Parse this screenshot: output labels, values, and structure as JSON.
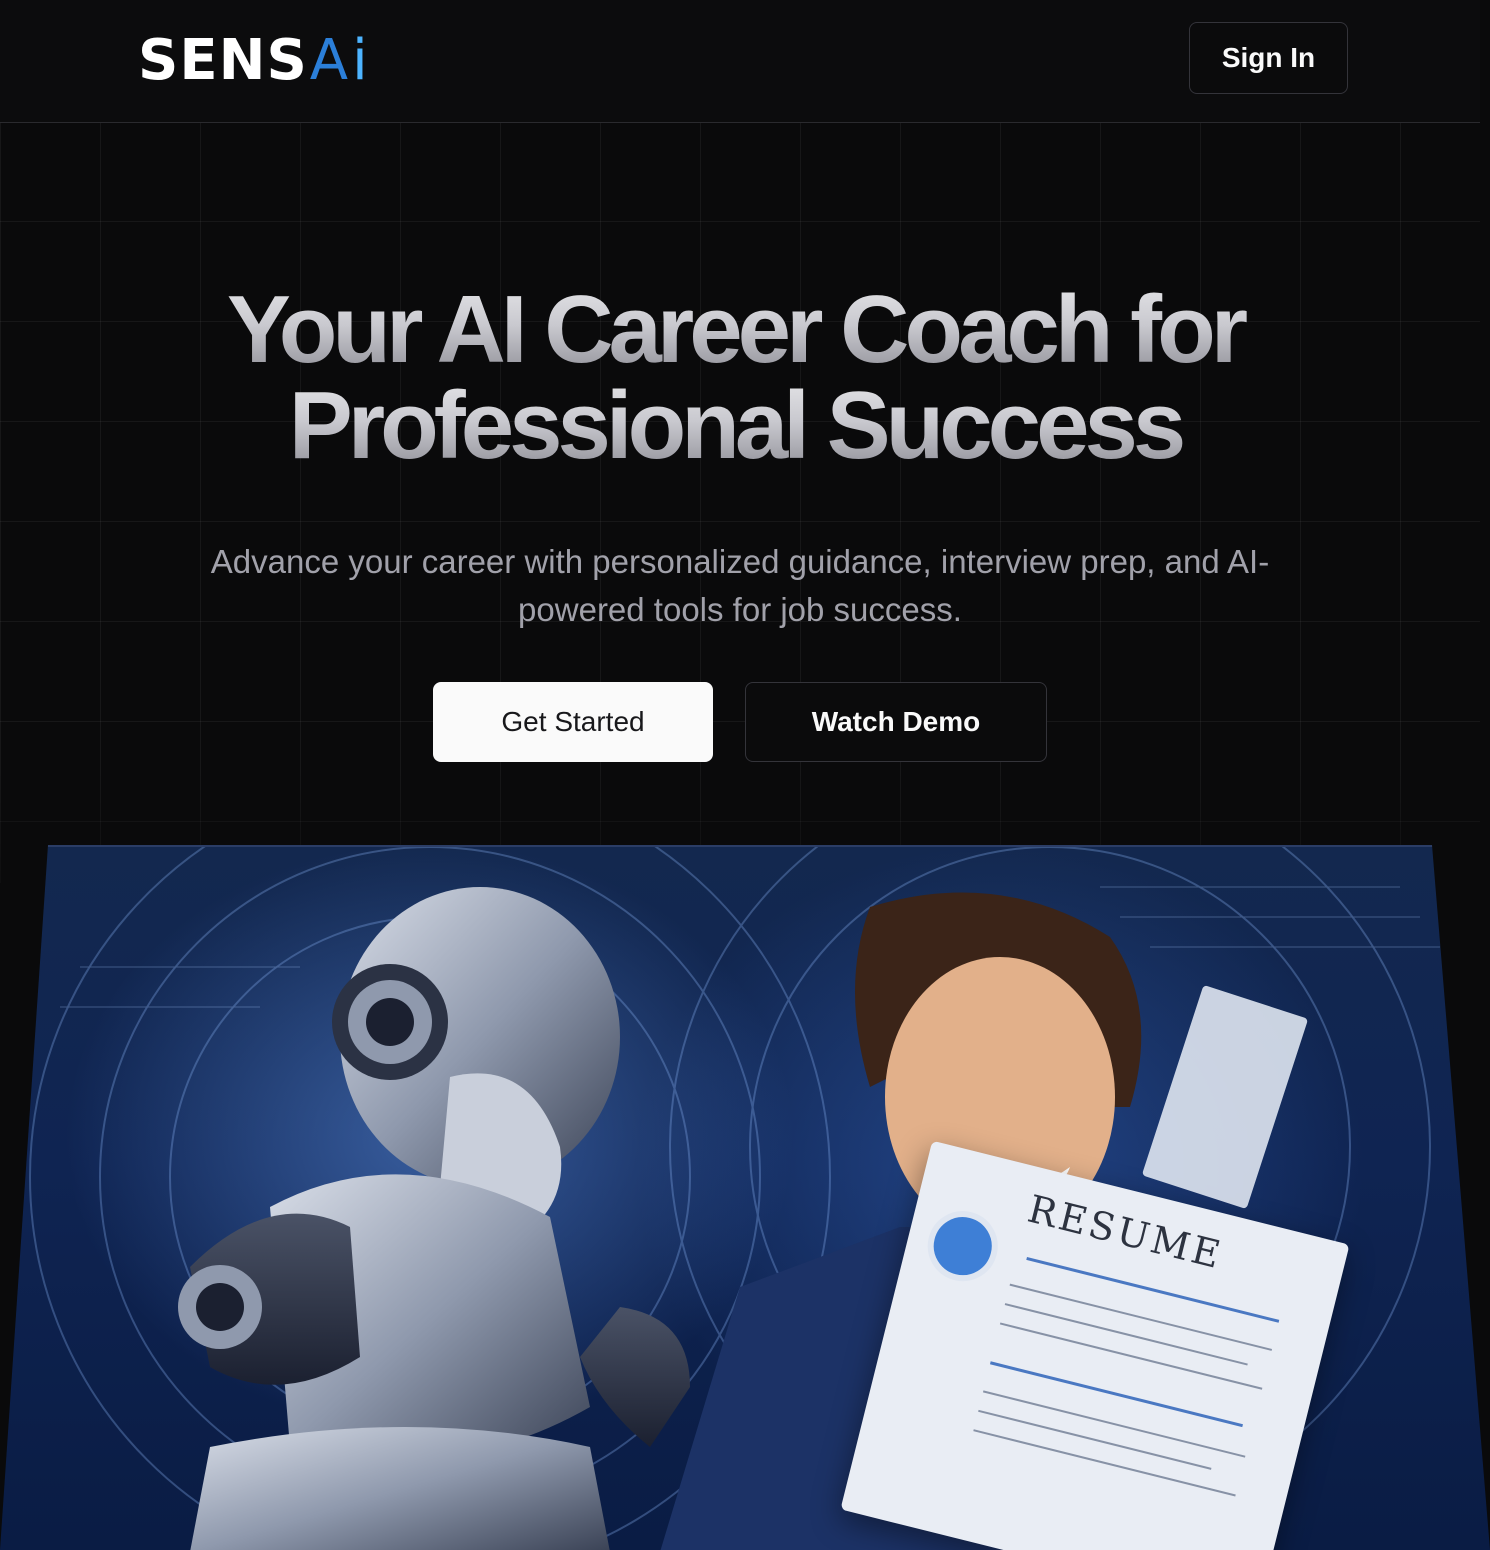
{
  "brand": {
    "logo_prefix": "SENS",
    "logo_suffix_a": "A",
    "logo_suffix_i": "i",
    "accent_color": "#2b7fd9"
  },
  "header": {
    "sign_in_label": "Sign In"
  },
  "hero": {
    "title_line1": "Your AI Career Coach for",
    "title_line2": "Professional Success",
    "subtitle": "Advance your career with personalized guidance, interview prep, and AI-powered tools for job success.",
    "primary_cta": "Get Started",
    "secondary_cta": "Watch Demo"
  },
  "hero_image": {
    "resume_heading": "RESUME",
    "alt_description_icon": "robot-and-person-reviewing-resume-illustration"
  }
}
